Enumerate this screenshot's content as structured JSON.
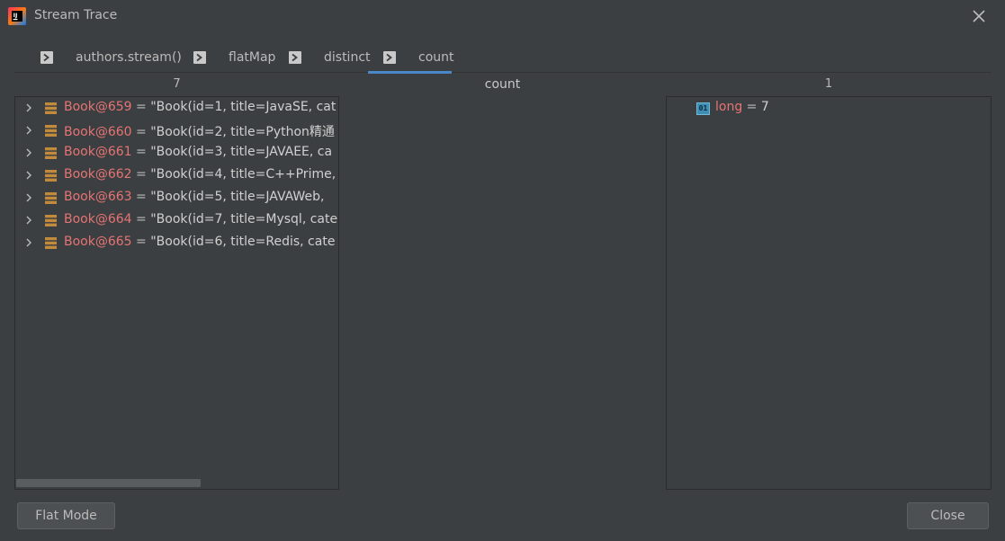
{
  "window": {
    "title": "Stream Trace"
  },
  "tabs": [
    {
      "label": "authors.stream()"
    },
    {
      "label": "flatMap"
    },
    {
      "label": "distinct"
    },
    {
      "label": "count",
      "active": true
    }
  ],
  "columns": {
    "left_count": "7",
    "middle_title": "count",
    "right_count": "1"
  },
  "left_items": [
    {
      "name": "Book@659",
      "eq": " = ",
      "value": "\"Book(id=1, title=JavaSE, cat"
    },
    {
      "name": "Book@660",
      "eq": " = ",
      "value": "\"Book(id=2, title=Python精通"
    },
    {
      "name": "Book@661",
      "eq": " = ",
      "value": "\"Book(id=3, title=JAVAEE, ca"
    },
    {
      "name": "Book@662",
      "eq": " = ",
      "value": "\"Book(id=4, title=C++Prime,"
    },
    {
      "name": "Book@663",
      "eq": " = ",
      "value": "\"Book(id=5, title=JAVAWeb,"
    },
    {
      "name": "Book@664",
      "eq": " = ",
      "value": "\"Book(id=7, title=Mysql, cate"
    },
    {
      "name": "Book@665",
      "eq": " = ",
      "value": "\"Book(id=6, title=Redis, cate"
    }
  ],
  "right_items": [
    {
      "icon_text": "01",
      "name": "long",
      "eq": " = ",
      "value": "7"
    }
  ],
  "buttons": {
    "flat_mode": "Flat Mode",
    "close": "Close"
  },
  "colors": {
    "background": "#3c3f41",
    "accent": "#4a88c7",
    "variable_name": "#e57474",
    "field_icon": "#c28a3c"
  }
}
